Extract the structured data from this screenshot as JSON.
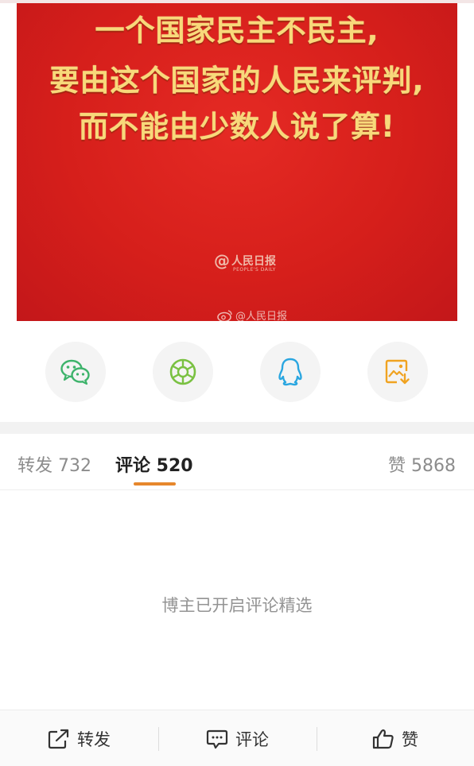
{
  "poster": {
    "line1": "一个国家民主不民主,",
    "line2": "要由这个国家的人民来评判,",
    "line3": "而不能由少数人说了算!",
    "logo_text": "人民日报",
    "logo_subtext": "PEOPLE'S DAILY",
    "watermark": "@人民日报"
  },
  "share": {
    "icons": [
      "wechat-icon",
      "moments-icon",
      "qq-icon",
      "save-image-icon"
    ]
  },
  "tabs": {
    "repost_label": "转发 732",
    "comment_label": "评论 520",
    "like_label": "赞 5868",
    "active": "comment"
  },
  "notice": "博主已开启评论精选",
  "action_bar": {
    "repost": "转发",
    "comment": "评论",
    "like": "赞"
  },
  "colors": {
    "poster_red": "#d61f1b",
    "poster_gold": "#f8d97a",
    "tab_underline": "#e6872c",
    "wechat_green": "#3db36b",
    "moments_green": "#7ac142",
    "qq_blue": "#2aa6e0",
    "save_orange": "#f0a321"
  }
}
